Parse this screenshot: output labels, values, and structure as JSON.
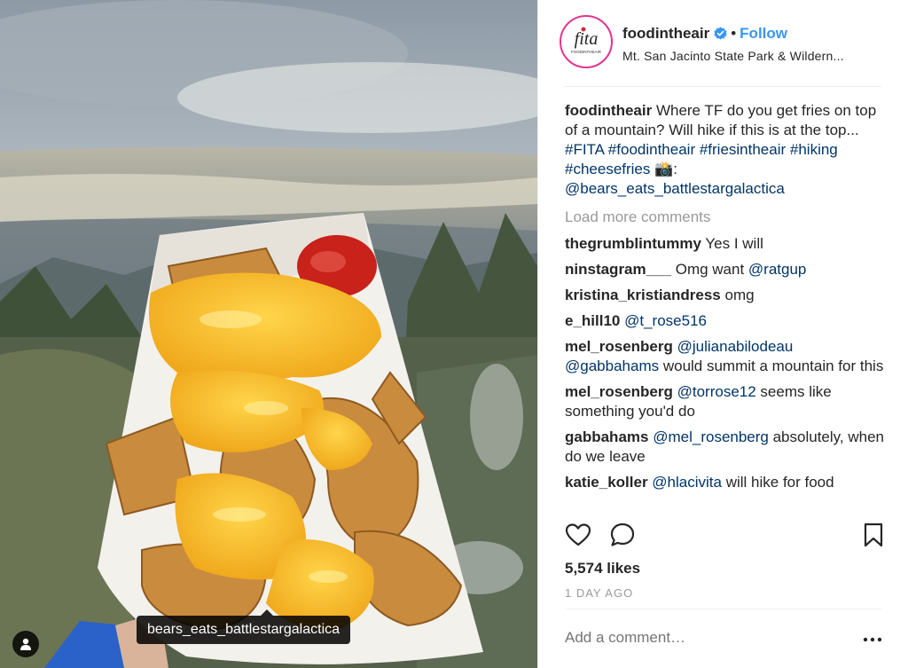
{
  "photo": {
    "tagged_user": "bears_eats_battlestargalactica",
    "user_tag_icon": "person-icon"
  },
  "header": {
    "avatar_text": "fita",
    "avatar_subtext": "FOODINTHEAIR",
    "username": "foodintheair",
    "verified_icon": "verified-badge-icon",
    "separator": "•",
    "follow_label": "Follow",
    "location": "Mt. San Jacinto State Park & Wildern..."
  },
  "caption": {
    "username": "foodintheair",
    "text": " Where TF do you get fries on top of a mountain? Will hike if this is at the top... ",
    "hashtags": "#FITA #foodintheair #friesintheair #hiking #cheesefries",
    "emoji": "📸",
    "colon": ":",
    "mention": "@bears_eats_battlestargalactica"
  },
  "load_more_label": "Load more comments",
  "comments": [
    {
      "user": "thegrumblintummy",
      "pre": " Yes I will",
      "mention": "",
      "post": ""
    },
    {
      "user": "ninstagram___",
      "pre": " Omg want ",
      "mention": "@ratgup",
      "post": ""
    },
    {
      "user": "kristina_kristiandress",
      "pre": " omg",
      "mention": "",
      "post": ""
    },
    {
      "user": "e_hill10",
      "pre": " ",
      "mention": "@t_rose516",
      "post": ""
    },
    {
      "user": "mel_rosenberg",
      "pre": " ",
      "mention": "@julianabilodeau @gabbahams",
      "post": " would summit a mountain for this"
    },
    {
      "user": "mel_rosenberg",
      "pre": " ",
      "mention": "@torrose12",
      "post": " seems like something you'd do"
    },
    {
      "user": "gabbahams",
      "pre": " ",
      "mention": "@mel_rosenberg",
      "post": " absolutely, when do we leave"
    },
    {
      "user": "katie_koller",
      "pre": " ",
      "mention": "@hlacivita",
      "post": " will hike for food"
    }
  ],
  "actions": {
    "like_icon": "heart-icon",
    "comment_icon": "comment-bubble-icon",
    "save_icon": "bookmark-icon"
  },
  "likes": "5,574 likes",
  "timestamp": "1 DAY AGO",
  "add_comment_placeholder": "Add a comment…",
  "more_icon": "ellipsis-icon",
  "colors": {
    "follow_blue": "#3897f0",
    "link_navy": "#003569",
    "muted_gray": "#999999",
    "text": "#262626",
    "avatar_ring": "#e3338e"
  }
}
